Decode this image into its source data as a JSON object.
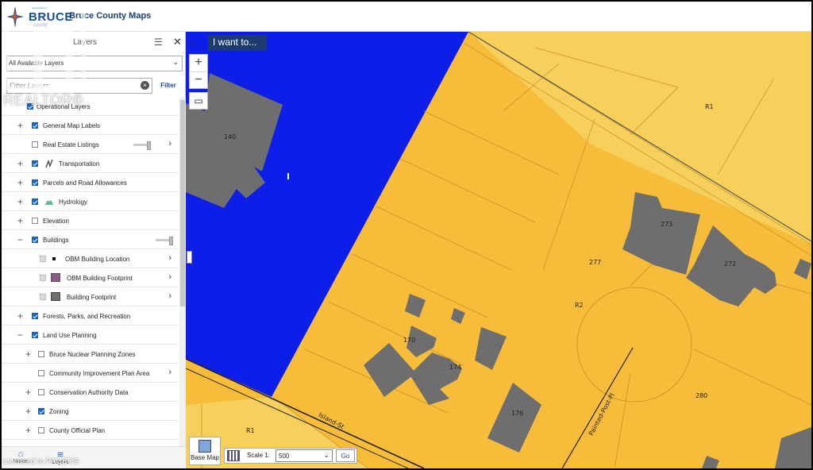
{
  "header": {
    "logo": {
      "small": "experience",
      "brand": "BRUCE",
      "sub": "county"
    },
    "title": "Bruce County Maps"
  },
  "panel": {
    "title": "Layers",
    "menu_icon": "list-icon",
    "close_icon": "close-icon",
    "layer_select": "All Available Layers",
    "filter_placeholder": "Filter Layers...",
    "filter_button": "Filter",
    "layers": [
      {
        "label": "Operational Layers",
        "checked": true
      },
      {
        "label": "General Map Labels",
        "checked": true
      },
      {
        "label": "Real Estate Listings",
        "checked": false
      },
      {
        "label": "Transportation",
        "checked": true
      },
      {
        "label": "Parcels and Road Allowances",
        "checked": true
      },
      {
        "label": "Hydrology",
        "checked": true
      },
      {
        "label": "Elevation",
        "checked": false
      },
      {
        "label": "Buildings",
        "checked": true
      },
      {
        "label": "OBM Building Location",
        "checked": true
      },
      {
        "label": "OBM Building Footprint",
        "checked": true
      },
      {
        "label": "Building Footprint",
        "checked": true
      },
      {
        "label": "Forests, Parks, and Recreation",
        "checked": true
      },
      {
        "label": "Land Use Planning",
        "checked": true
      },
      {
        "label": "Bruce Nuclear Planning Zones",
        "checked": false
      },
      {
        "label": "Community Improvement Plan Area",
        "checked": false
      },
      {
        "label": "Conservation Authority Data",
        "checked": false
      },
      {
        "label": "Zoning",
        "checked": true
      },
      {
        "label": "County Official Plan",
        "checked": false
      }
    ],
    "footer": {
      "home": "Home",
      "layers": "Layers"
    }
  },
  "map": {
    "i_want_to": "I want to...",
    "zoom_in": "+",
    "zoom_out": "−",
    "basemap_label": "Base Map",
    "scale_label": "Scale 1:",
    "scale_value": "500",
    "go_label": "Go",
    "labels": {
      "b140": "140",
      "r1_top": "R1",
      "b273": "273",
      "b272": "272",
      "b277": "277",
      "r2": "R2",
      "b170": "170",
      "b174": "174",
      "b176": "176",
      "b280": "280",
      "r1_bottom": "R1",
      "island_st": "Island-St",
      "painted_post": "Painted-Post-Pl"
    },
    "colors": {
      "zone_r2": "#f6bc3a",
      "zone_r1": "#f7cf5b",
      "water_blue": "#0c1ee8",
      "building": "#6e6e6e"
    }
  },
  "watermarks": {
    "realtor": "REALTOR®",
    "licence": "Licensed to PAGEOS"
  }
}
